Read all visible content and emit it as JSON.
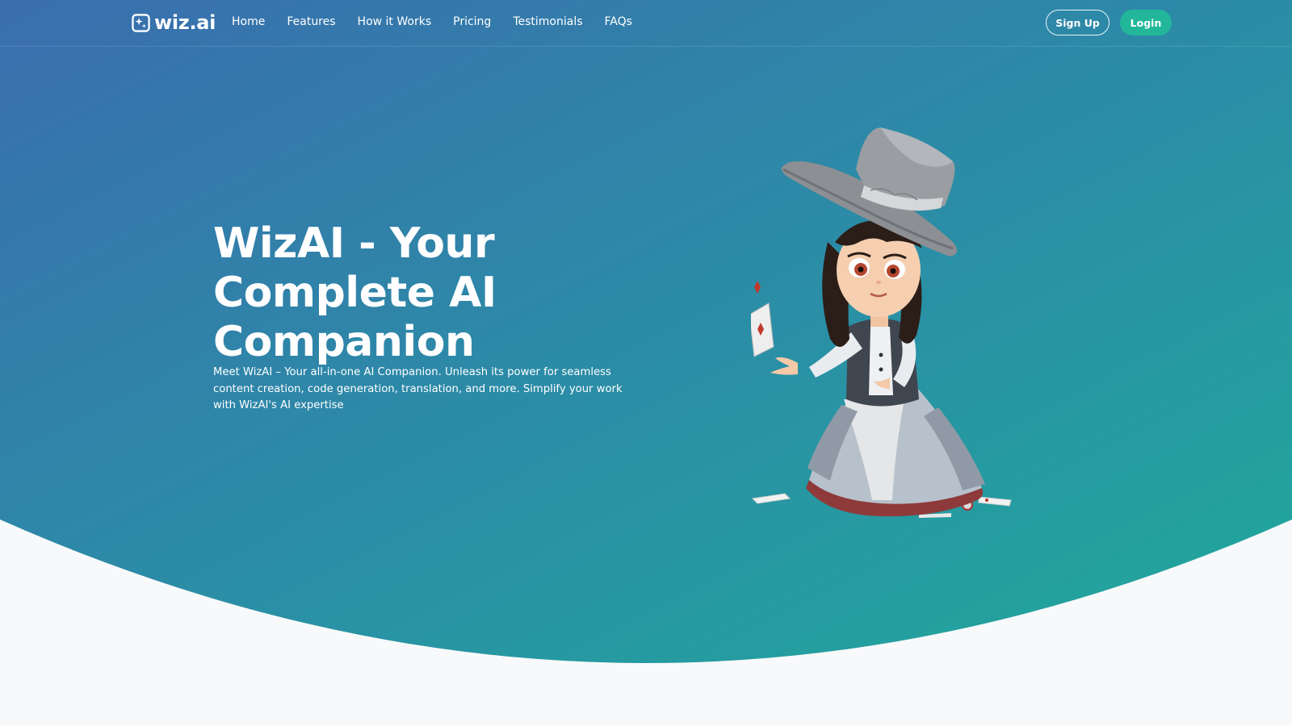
{
  "brand": {
    "name": "wiz.ai",
    "icon": "sparkle-square-icon",
    "colors": {
      "gradient_start": "#3a6eae",
      "gradient_end": "#22a89a",
      "login_button": "#22b79a",
      "page_bg": "#f8f9fa"
    }
  },
  "nav": {
    "links": [
      {
        "label": "Home"
      },
      {
        "label": "Features"
      },
      {
        "label": "How it Works"
      },
      {
        "label": "Pricing"
      },
      {
        "label": "Testimonials"
      },
      {
        "label": "FAQs"
      }
    ],
    "signup_label": "Sign Up",
    "login_label": "Login"
  },
  "hero": {
    "title": "WizAI - Your Complete AI Companion",
    "description": "Meet WizAI – Your all-in-one AI Companion. Unleash its power for seamless content creation, code generation, translation, and more. Simplify your work with WizAI's AI expertise",
    "illustration": "wizard-girl-with-top-hat-and-cards"
  }
}
